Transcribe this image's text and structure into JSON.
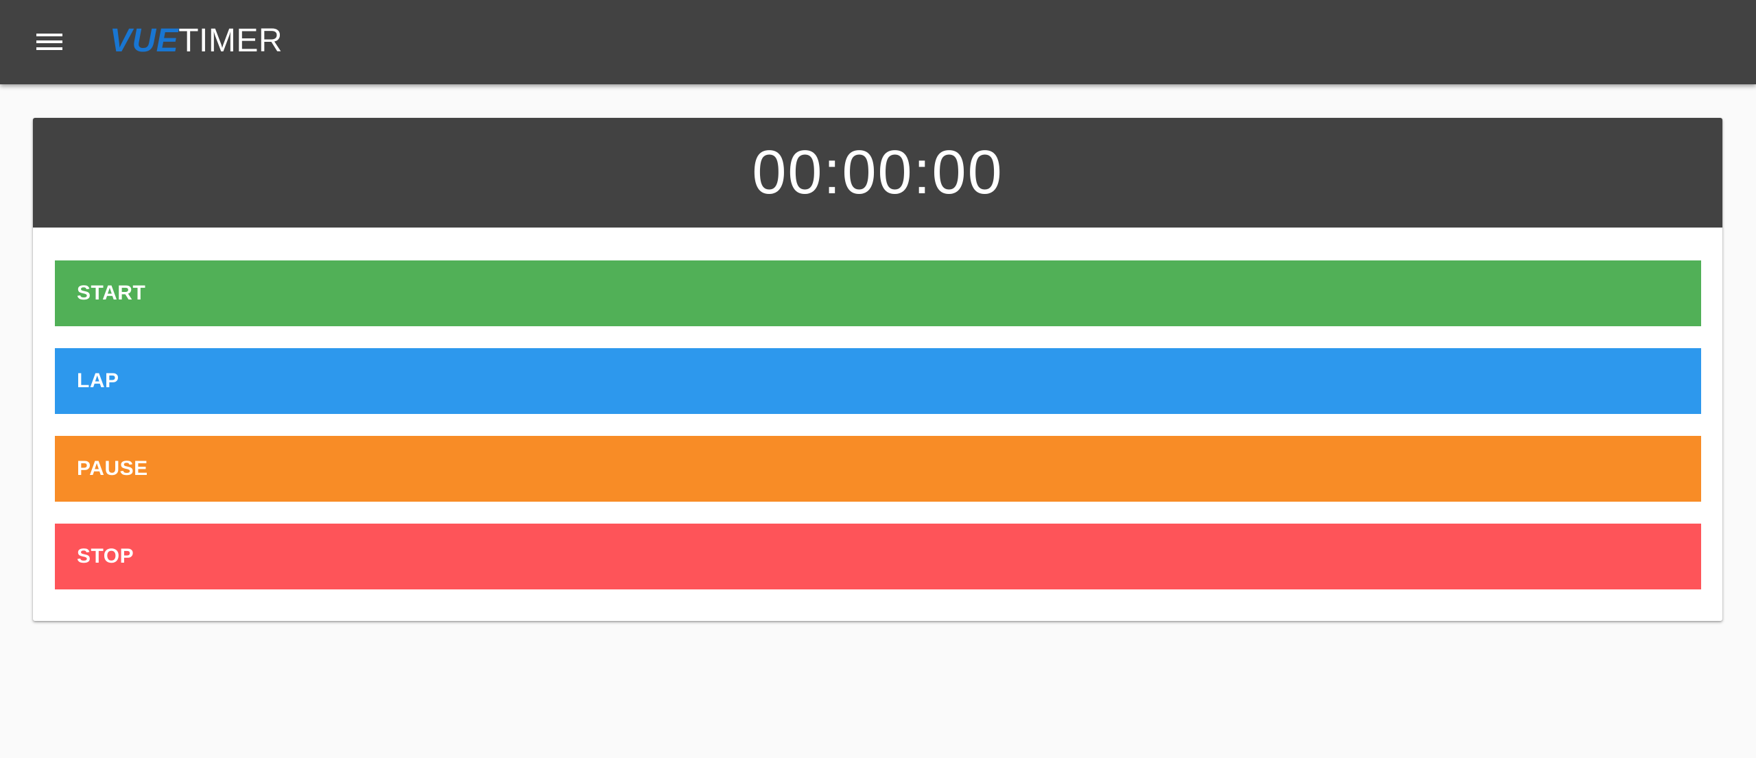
{
  "app": {
    "brand_bold": "VUE",
    "brand_light": "TIMER"
  },
  "toolbar": {
    "menu_icon": "menu-icon"
  },
  "timer": {
    "display": "00:00:00"
  },
  "buttons": {
    "start": "START",
    "lap": "LAP",
    "pause": "PAUSE",
    "stop": "STOP"
  },
  "colors": {
    "toolbar": "#424242",
    "brand_accent": "#1976d2",
    "start": "#51b057",
    "lap": "#2d98ed",
    "pause": "#f88c26",
    "stop": "#fe5459",
    "background": "#fafafa"
  }
}
